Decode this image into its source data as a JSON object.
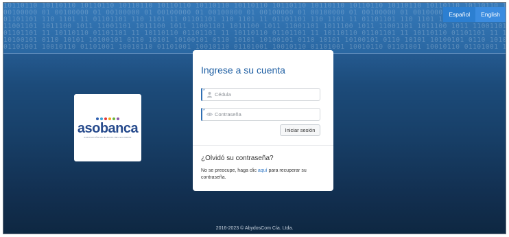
{
  "background": {
    "binary_lines": [
      "10110110 10110110 10110110 10110110 10110110 10110110 10110110 10110110 10110110 10110110 10110110 10110110 10110110 10110110 10110110 10110110 10110110 10110110",
      "00100000 01 00100000 01 00100000 01 00100000 01 00100000 01 00100000 01 00100000 01 00100000 01 00100000 01 00100000 01 00100000 01 00100000 01 00100000 01",
      "01101101 110 1101 11 01101101 110 1101 11 01101101 110 1101 11 01101101 110 1101 11 01101101 110 1101 11 01101101 110 1101 11 01101101 110 1101 11",
      "11001101 1011100 1011 11001101 1011100 1011 11001101 1011100 1011 11001101 1011100 1011 11001101 1011100 1011 11001101 1011100 1011 11001101 1011100",
      "01101101 11 10110110 01101101 11 10110110 01101101 11 10110110 01101101 11 10110110 01101101 11 10110110 01101101 11 10110110 01101101 11 10110110",
      "10100101 0110 10101 10100101 0110 10101 10100101 0110 10101 10100101 0110 10101 10100101 0110 10101 10100101 0110 10101 10100101 0110 10101 10100101",
      "01101001 10010110 01101001 10010110 01101001 10010110 01101001 10010110 01101001 10010110 01101001 10010110 01101001 10010110 01101001 10010110"
    ]
  },
  "language": {
    "options": [
      "Español",
      "English"
    ]
  },
  "logo": {
    "text": "asobanca",
    "tagline": "ASOCIACIÓN DE BANCOS DEL ECUADOR",
    "dot_colors": [
      "#2f5fb0",
      "#3aa3d9",
      "#e23b3b",
      "#f2a31b",
      "#6cb33f",
      "#8a56a8"
    ]
  },
  "login": {
    "title": "Ingrese a su cuenta",
    "cedula_placeholder": "Cédula",
    "password_placeholder": "Contraseña",
    "submit_label": "Iniciar sesión",
    "forgot_title": "¿Olvidó su contraseña?",
    "forgot_prefix": "No se preocupe, haga clic ",
    "forgot_link": "aquí",
    "forgot_suffix": " para recuperar su contraseña."
  },
  "footer": {
    "text": "2016-2023 © AbydosCom Cía. Ltda."
  },
  "colors": {
    "accent": "#2f6fb3",
    "title": "#1f5fa3",
    "lang_button": "#2c7fd1"
  },
  "icons": {
    "cedula": "user-icon",
    "password": "eye-icon"
  }
}
